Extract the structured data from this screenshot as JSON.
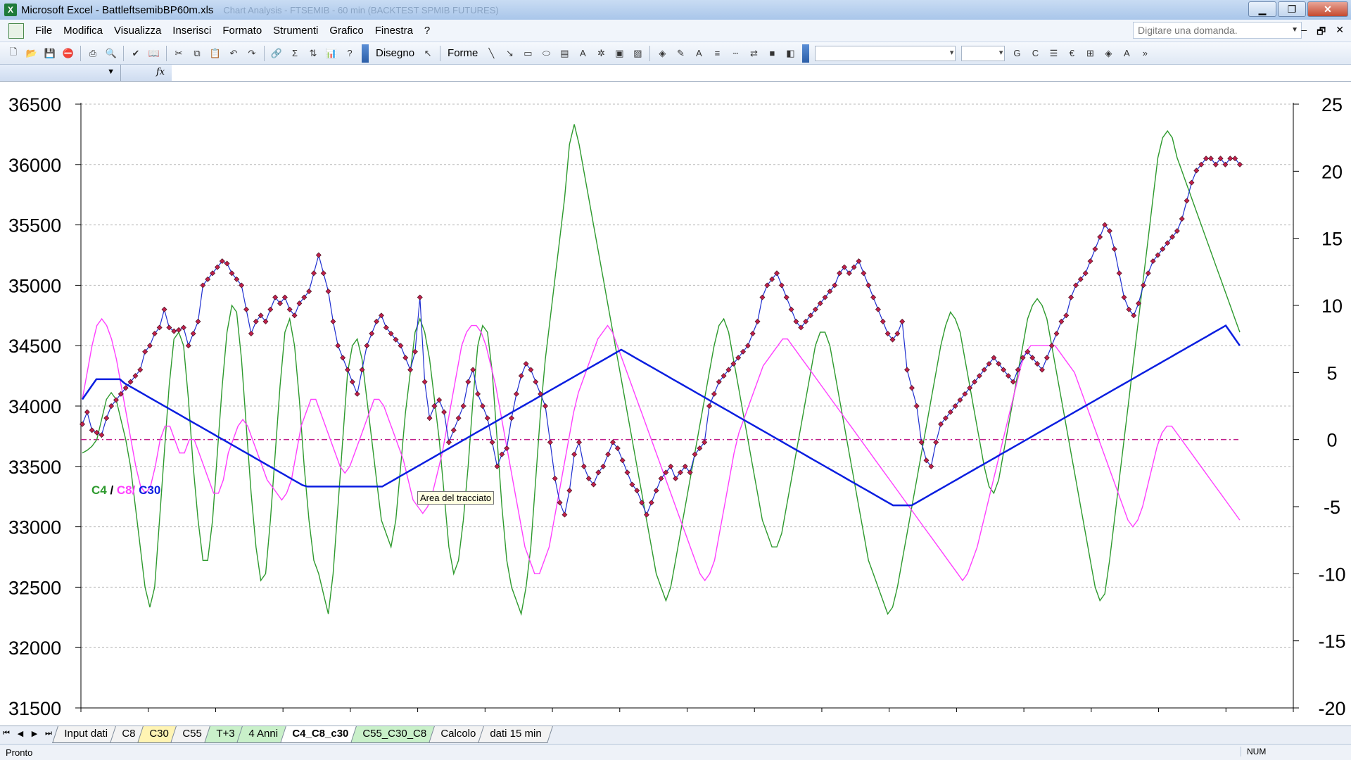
{
  "window": {
    "title": "Microsoft Excel - BattleftsemibBP60m.xls",
    "title_ghost": "Chart Analysis - FTSEMIB - 60 min  (BACKTEST SPMIB FUTURES)",
    "minimize": "▁",
    "restore": "❐",
    "close": "✕"
  },
  "menubar": {
    "items": [
      "File",
      "Modifica",
      "Visualizza",
      "Inserisci",
      "Formato",
      "Strumenti",
      "Grafico",
      "Finestra",
      "?"
    ],
    "ask_placeholder": "Digitare una domanda.",
    "ctrl_min": "‒",
    "ctrl_restore": "🗗",
    "ctrl_close": "✕"
  },
  "toolbar": {
    "disegno_label": "Disegno",
    "forme_label": "Forme",
    "font_bold": "G",
    "font_italic": "C",
    "euro": "€"
  },
  "chart": {
    "legend": {
      "c4": "C4",
      "sep1": " / ",
      "c8": "C8/",
      "c30": " C30"
    },
    "tooltip": "Area del tracciato",
    "colors": {
      "price": "#1f2fd0",
      "price_marker": "#c0204a",
      "c4": "#2e9a2e",
      "c8": "#ff40ff",
      "c30": "#0a1ee0",
      "zero": "#c0208a"
    }
  },
  "chart_data": {
    "type": "line",
    "left_axis": {
      "ticks": [
        "36500",
        "36000",
        "35500",
        "35000",
        "34500",
        "34000",
        "33500",
        "33000",
        "32500",
        "32000",
        "31500"
      ],
      "ylim": [
        31500,
        36500
      ]
    },
    "right_axis": {
      "ticks": [
        "25",
        "20",
        "15",
        "10",
        "5",
        "0",
        "-5",
        "-10",
        "-15",
        "-20"
      ],
      "ylim": [
        -20,
        25
      ]
    },
    "grid": true,
    "x_points": 240,
    "series": [
      {
        "name": "",
        "axis": "left",
        "markers": true,
        "values": [
          33850,
          33950,
          33800,
          33780,
          33760,
          33900,
          34000,
          34050,
          34100,
          34150,
          34200,
          34250,
          34300,
          34450,
          34500,
          34600,
          34650,
          34800,
          34650,
          34620,
          34630,
          34650,
          34500,
          34600,
          34700,
          35000,
          35050,
          35100,
          35150,
          35200,
          35180,
          35100,
          35050,
          35000,
          34800,
          34600,
          34700,
          34750,
          34700,
          34800,
          34900,
          34850,
          34900,
          34800,
          34750,
          34850,
          34900,
          34950,
          35100,
          35250,
          35100,
          34950,
          34700,
          34500,
          34400,
          34300,
          34200,
          34100,
          34300,
          34500,
          34600,
          34700,
          34750,
          34650,
          34600,
          34550,
          34500,
          34400,
          34300,
          34450,
          34900,
          34200,
          33900,
          34000,
          34050,
          33950,
          33700,
          33800,
          33900,
          34000,
          34200,
          34300,
          34100,
          34000,
          33900,
          33700,
          33500,
          33600,
          33650,
          33900,
          34100,
          34250,
          34350,
          34300,
          34200,
          34100,
          34000,
          33700,
          33400,
          33200,
          33100,
          33300,
          33600,
          33700,
          33500,
          33400,
          33350,
          33450,
          33500,
          33600,
          33700,
          33650,
          33550,
          33450,
          33350,
          33300,
          33200,
          33100,
          33200,
          33300,
          33400,
          33450,
          33500,
          33400,
          33450,
          33500,
          33450,
          33600,
          33650,
          33700,
          34000,
          34100,
          34200,
          34250,
          34300,
          34350,
          34400,
          34450,
          34500,
          34600,
          34700,
          34900,
          35000,
          35050,
          35100,
          35000,
          34900,
          34800,
          34700,
          34650,
          34700,
          34750,
          34800,
          34850,
          34900,
          34950,
          35000,
          35100,
          35150,
          35100,
          35150,
          35200,
          35100,
          35000,
          34900,
          34800,
          34700,
          34600,
          34550,
          34600,
          34700,
          34300,
          34150,
          34000,
          33700,
          33550,
          33500,
          33700,
          33850,
          33900,
          33950,
          34000,
          34050,
          34100,
          34150,
          34200,
          34250,
          34300,
          34350,
          34400,
          34350,
          34300,
          34250,
          34200,
          34300,
          34400,
          34450,
          34400,
          34350,
          34300,
          34400,
          34500,
          34600,
          34700,
          34750,
          34900,
          35000,
          35050,
          35100,
          35200,
          35300,
          35400,
          35500,
          35450,
          35300,
          35100,
          34900,
          34800,
          34750,
          34850,
          35000,
          35100,
          35200,
          35250,
          35300,
          35350,
          35400,
          35450,
          35550,
          35700,
          35850,
          35950,
          36000,
          36050,
          36050,
          36000,
          36050,
          36000,
          36050,
          36050,
          36000
        ]
      },
      {
        "name": "C4",
        "axis": "right",
        "values": [
          -1.0,
          -0.8,
          -0.5,
          0.0,
          1.5,
          3.0,
          3.5,
          3.0,
          1.5,
          0.0,
          -2.0,
          -5.0,
          -8.0,
          -11.0,
          -12.5,
          -11.0,
          -6.0,
          -1.0,
          4.0,
          7.5,
          8.0,
          7.0,
          3.0,
          -2.0,
          -6.0,
          -9.0,
          -9.0,
          -6.0,
          -1.0,
          4.0,
          8.0,
          10.0,
          9.5,
          6.0,
          1.0,
          -4.0,
          -8.0,
          -10.5,
          -10.0,
          -6.0,
          -1.0,
          4.0,
          8.0,
          9.0,
          7.0,
          3.0,
          -2.0,
          -6.0,
          -9.0,
          -10.0,
          -11.5,
          -13.0,
          -10.0,
          -5.0,
          0.0,
          5.0,
          7.0,
          7.5,
          6.0,
          3.0,
          0.0,
          -3.0,
          -6.0,
          -7.0,
          -8.0,
          -6.0,
          -2.0,
          2.0,
          5.0,
          8.0,
          9.0,
          8.0,
          6.0,
          3.0,
          0.0,
          -4.0,
          -8.0,
          -10.0,
          -9.0,
          -6.0,
          -2.0,
          3.0,
          7.0,
          8.5,
          8.0,
          5.0,
          0.0,
          -5.0,
          -9.0,
          -11.0,
          -12.0,
          -13.0,
          -11.0,
          -8.0,
          -3.0,
          2.0,
          6.0,
          9.0,
          12.0,
          15.0,
          18.0,
          22.0,
          23.5,
          22.0,
          20.0,
          18.0,
          16.0,
          14.0,
          12.0,
          10.0,
          8.0,
          6.0,
          4.0,
          2.0,
          0.0,
          -2.0,
          -4.0,
          -6.0,
          -8.0,
          -10.0,
          -11.0,
          -12.0,
          -11.0,
          -9.0,
          -7.0,
          -5.0,
          -3.0,
          -1.0,
          1.0,
          3.0,
          5.0,
          7.0,
          8.5,
          9.0,
          8.0,
          6.0,
          4.0,
          2.0,
          0.0,
          -2.0,
          -4.0,
          -6.0,
          -7.0,
          -8.0,
          -8.0,
          -7.0,
          -5.0,
          -3.0,
          -1.0,
          1.0,
          3.0,
          5.0,
          7.0,
          8.0,
          8.0,
          7.0,
          5.0,
          3.0,
          1.0,
          -1.0,
          -3.0,
          -5.0,
          -7.0,
          -9.0,
          -10.0,
          -11.0,
          -12.0,
          -13.0,
          -12.5,
          -11.0,
          -9.0,
          -7.0,
          -5.0,
          -3.0,
          -1.0,
          1.0,
          3.0,
          5.0,
          7.0,
          8.5,
          9.5,
          9.0,
          8.0,
          6.0,
          4.0,
          2.0,
          0.0,
          -2.0,
          -3.5,
          -4.0,
          -3.0,
          -1.0,
          1.0,
          3.0,
          5.0,
          7.0,
          9.0,
          10.0,
          10.5,
          10.0,
          9.0,
          7.0,
          5.0,
          3.0,
          1.0,
          -1.0,
          -3.0,
          -5.0,
          -7.0,
          -9.0,
          -11.0,
          -12.0,
          -11.5,
          -9.0,
          -6.0,
          -3.0,
          0.0,
          3.0,
          6.0,
          9.0,
          12.0,
          15.0,
          18.0,
          21.0,
          22.5,
          23.0,
          22.5,
          21.0,
          20.0,
          19.0,
          18.0,
          17.0,
          16.0,
          15.0,
          14.0,
          13.0,
          12.0,
          11.0,
          10.0,
          9.0,
          8.0
        ]
      },
      {
        "name": "C8",
        "axis": "right",
        "values": [
          3.0,
          5.0,
          7.0,
          8.5,
          9.0,
          8.5,
          7.5,
          6.0,
          4.0,
          2.0,
          0.0,
          -2.0,
          -3.5,
          -4.0,
          -3.5,
          -2.0,
          0.0,
          1.0,
          1.0,
          0.0,
          -1.0,
          -1.0,
          0.0,
          0.0,
          -1.0,
          -2.0,
          -3.0,
          -4.0,
          -4.0,
          -3.0,
          -1.0,
          0.0,
          1.0,
          1.5,
          1.0,
          0.0,
          -1.0,
          -2.0,
          -3.0,
          -3.5,
          -4.0,
          -4.5,
          -4.0,
          -3.0,
          -1.0,
          1.0,
          2.0,
          3.0,
          3.0,
          2.0,
          1.0,
          0.0,
          -1.0,
          -2.0,
          -2.5,
          -2.0,
          -1.0,
          0.0,
          1.0,
          2.0,
          3.0,
          3.0,
          2.5,
          1.5,
          0.5,
          -0.5,
          -1.5,
          -3.0,
          -4.5,
          -5.0,
          -5.5,
          -5.0,
          -4.0,
          -2.5,
          -1.0,
          1.0,
          3.0,
          5.0,
          7.0,
          8.0,
          8.5,
          8.5,
          8.0,
          7.0,
          5.5,
          4.0,
          2.0,
          0.0,
          -2.0,
          -4.0,
          -6.0,
          -8.0,
          -9.0,
          -10.0,
          -10.0,
          -9.0,
          -8.0,
          -6.0,
          -4.0,
          -2.0,
          0.0,
          2.0,
          3.5,
          4.5,
          5.5,
          6.5,
          7.5,
          8.0,
          8.5,
          8.0,
          7.0,
          6.0,
          5.0,
          4.0,
          3.0,
          2.0,
          1.0,
          0.0,
          -1.0,
          -2.0,
          -3.0,
          -4.0,
          -5.0,
          -6.0,
          -7.0,
          -8.0,
          -9.0,
          -10.0,
          -10.5,
          -10.0,
          -9.0,
          -7.0,
          -5.0,
          -3.0,
          -1.0,
          0.5,
          1.5,
          2.5,
          3.5,
          4.5,
          5.5,
          6.0,
          6.5,
          7.0,
          7.5,
          7.5,
          7.0,
          6.5,
          6.0,
          5.5,
          5.0,
          4.5,
          4.0,
          3.5,
          3.0,
          2.5,
          2.0,
          1.5,
          1.0,
          0.5,
          0.0,
          -0.5,
          -1.0,
          -1.5,
          -2.0,
          -2.5,
          -3.0,
          -3.5,
          -4.0,
          -4.5,
          -5.0,
          -5.5,
          -6.0,
          -6.5,
          -7.0,
          -7.5,
          -8.0,
          -8.5,
          -9.0,
          -9.5,
          -10.0,
          -10.5,
          -10.0,
          -9.0,
          -8.0,
          -6.5,
          -5.0,
          -3.5,
          -2.0,
          -0.5,
          1.0,
          2.5,
          4.0,
          5.5,
          6.5,
          7.0,
          7.0,
          7.0,
          7.0,
          7.0,
          7.0,
          6.5,
          6.0,
          5.5,
          5.0,
          4.0,
          3.0,
          2.0,
          1.0,
          0.0,
          -1.0,
          -2.0,
          -3.0,
          -4.0,
          -5.0,
          -6.0,
          -6.5,
          -6.0,
          -5.0,
          -3.5,
          -2.0,
          -0.5,
          0.5,
          1.0,
          1.0,
          0.5,
          0.0,
          -0.5,
          -1.0,
          -1.5,
          -2.0,
          -2.5,
          -3.0,
          -3.5,
          -4.0,
          -4.5,
          -5.0,
          -5.5,
          -6.0
        ]
      },
      {
        "name": "C30",
        "axis": "right",
        "values": [
          3.0,
          3.5,
          4.0,
          4.5,
          4.5,
          4.5,
          4.5,
          4.5,
          4.5,
          4.2,
          4.0,
          3.8,
          3.6,
          3.4,
          3.2,
          3.0,
          2.8,
          2.6,
          2.4,
          2.2,
          2.0,
          1.8,
          1.6,
          1.4,
          1.2,
          1.0,
          0.8,
          0.6,
          0.4,
          0.2,
          0.0,
          -0.2,
          -0.4,
          -0.6,
          -0.8,
          -1.0,
          -1.2,
          -1.4,
          -1.6,
          -1.8,
          -2.0,
          -2.2,
          -2.4,
          -2.6,
          -2.8,
          -3.0,
          -3.2,
          -3.4,
          -3.5,
          -3.5,
          -3.5,
          -3.5,
          -3.5,
          -3.5,
          -3.5,
          -3.5,
          -3.5,
          -3.5,
          -3.5,
          -3.5,
          -3.5,
          -3.5,
          -3.5,
          -3.5,
          -3.5,
          -3.3,
          -3.1,
          -2.9,
          -2.7,
          -2.5,
          -2.3,
          -2.1,
          -1.9,
          -1.7,
          -1.5,
          -1.3,
          -1.1,
          -0.9,
          -0.7,
          -0.5,
          -0.3,
          -0.1,
          0.1,
          0.3,
          0.5,
          0.7,
          0.9,
          1.1,
          1.3,
          1.5,
          1.7,
          1.9,
          2.1,
          2.3,
          2.5,
          2.7,
          2.9,
          3.1,
          3.3,
          3.5,
          3.7,
          3.9,
          4.1,
          4.3,
          4.5,
          4.7,
          4.9,
          5.1,
          5.3,
          5.5,
          5.7,
          5.9,
          6.1,
          6.3,
          6.5,
          6.7,
          6.5,
          6.3,
          6.1,
          5.9,
          5.7,
          5.5,
          5.3,
          5.1,
          4.9,
          4.7,
          4.5,
          4.3,
          4.1,
          3.9,
          3.7,
          3.5,
          3.3,
          3.1,
          2.9,
          2.7,
          2.5,
          2.3,
          2.1,
          1.9,
          1.7,
          1.5,
          1.3,
          1.1,
          0.9,
          0.7,
          0.5,
          0.3,
          0.1,
          -0.1,
          -0.3,
          -0.5,
          -0.7,
          -0.9,
          -1.1,
          -1.3,
          -1.5,
          -1.7,
          -1.9,
          -2.1,
          -2.3,
          -2.5,
          -2.7,
          -2.9,
          -3.1,
          -3.3,
          -3.5,
          -3.7,
          -3.9,
          -4.1,
          -4.3,
          -4.5,
          -4.7,
          -4.9,
          -4.9,
          -4.9,
          -4.9,
          -4.9,
          -4.7,
          -4.5,
          -4.3,
          -4.1,
          -3.9,
          -3.7,
          -3.5,
          -3.3,
          -3.1,
          -2.9,
          -2.7,
          -2.5,
          -2.3,
          -2.1,
          -1.9,
          -1.7,
          -1.5,
          -1.3,
          -1.1,
          -0.9,
          -0.7,
          -0.5,
          -0.3,
          -0.1,
          0.1,
          0.3,
          0.5,
          0.7,
          0.9,
          1.1,
          1.3,
          1.5,
          1.7,
          1.9,
          2.1,
          2.3,
          2.5,
          2.7,
          2.9,
          3.1,
          3.3,
          3.5,
          3.7,
          3.9,
          4.1,
          4.3,
          4.5,
          4.7,
          4.9,
          5.1,
          5.3,
          5.5,
          5.7,
          5.9,
          6.1,
          6.3,
          6.5,
          6.7,
          6.9,
          7.1,
          7.3,
          7.5,
          7.7,
          7.9,
          8.1,
          8.3,
          8.5,
          8.0,
          7.5,
          7.0
        ]
      },
      {
        "name": "",
        "axis": "right",
        "style": "dash-dot",
        "values": [
          0,
          0
        ]
      }
    ]
  },
  "sheets": {
    "tabs": [
      {
        "label": "Input dati",
        "style": "plain"
      },
      {
        "label": "C8",
        "style": "plain"
      },
      {
        "label": "C30",
        "style": "yellow"
      },
      {
        "label": "C55",
        "style": "plain"
      },
      {
        "label": "T+3",
        "style": "green"
      },
      {
        "label": "4 Anni",
        "style": "green"
      },
      {
        "label": "C4_C8_c30",
        "style": "active"
      },
      {
        "label": "C55_C30_C8",
        "style": "green"
      },
      {
        "label": "Calcolo",
        "style": "plain"
      },
      {
        "label": "dati 15 min",
        "style": "plain"
      }
    ]
  },
  "status": {
    "left": "Pronto",
    "num": "NUM"
  }
}
